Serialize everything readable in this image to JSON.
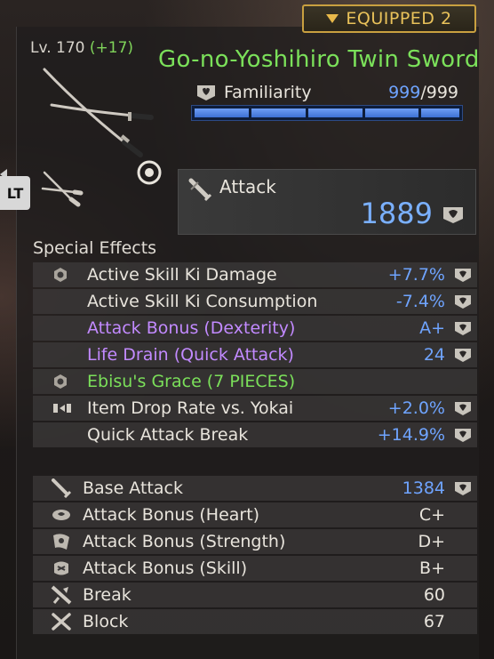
{
  "badge": {
    "label": "EQUIPPED 2"
  },
  "weapon": {
    "level": "Lv. 170",
    "level_bonus": "(+17)",
    "name": "Go-no-Yoshihiro Twin Swords"
  },
  "familiarity": {
    "label": "Familiarity",
    "current": "999",
    "max": "/999",
    "fill_fraction": 1.0
  },
  "swap_button": {
    "label": "LT"
  },
  "attack": {
    "label": "Attack",
    "value": "1889"
  },
  "special_effects": {
    "title": "Special Effects",
    "rows": [
      {
        "icon": "hex-gear-icon",
        "label": "Active Skill Ki Damage",
        "value": "+7.7%",
        "label_color": "white",
        "value_color": "blue",
        "gem": true
      },
      {
        "icon": "",
        "label": "Active Skill Ki Consumption",
        "value": "-7.4%",
        "label_color": "white",
        "value_color": "blue",
        "gem": true
      },
      {
        "icon": "",
        "label": "Attack Bonus (Dexterity)",
        "value": "A+",
        "label_color": "purple",
        "value_color": "blue",
        "gem": true
      },
      {
        "icon": "",
        "label": "Life Drain (Quick Attack)",
        "value": "24",
        "label_color": "purple",
        "value_color": "blue",
        "gem": true
      },
      {
        "icon": "hex-gear-icon",
        "label": "Ebisu's Grace (7 PIECES)",
        "value": "",
        "label_color": "green",
        "value_color": "blue",
        "gem": false
      },
      {
        "icon": "item-drop-icon",
        "label": "Item Drop Rate vs. Yokai",
        "value": "+2.0%",
        "label_color": "white",
        "value_color": "blue",
        "gem": true
      },
      {
        "icon": "",
        "label": "Quick Attack Break",
        "value": "+14.9%",
        "label_color": "white",
        "value_color": "blue",
        "gem": true
      }
    ]
  },
  "stats": {
    "rows": [
      {
        "icon": "sword-icon",
        "label": "Base Attack",
        "value": "1384",
        "value_color": "blue",
        "gem": true
      },
      {
        "icon": "heart-bonus-icon",
        "label": "Attack Bonus (Heart)",
        "value": "C+",
        "value_color": "white",
        "gem": false
      },
      {
        "icon": "strength-bonus-icon",
        "label": "Attack Bonus (Strength)",
        "value": "D+",
        "value_color": "white",
        "gem": false
      },
      {
        "icon": "skill-bonus-icon",
        "label": "Attack Bonus (Skill)",
        "value": "B+",
        "value_color": "white",
        "gem": false
      },
      {
        "icon": "break-icon",
        "label": "Break",
        "value": "60",
        "value_color": "white",
        "gem": false
      },
      {
        "icon": "block-icon",
        "label": "Block",
        "value": "67",
        "value_color": "white",
        "gem": false
      }
    ]
  },
  "colors": {
    "accent_gold": "#e9c25a",
    "name_green": "#7be05a",
    "value_blue": "#6fa4ff",
    "purple": "#c28aff"
  }
}
